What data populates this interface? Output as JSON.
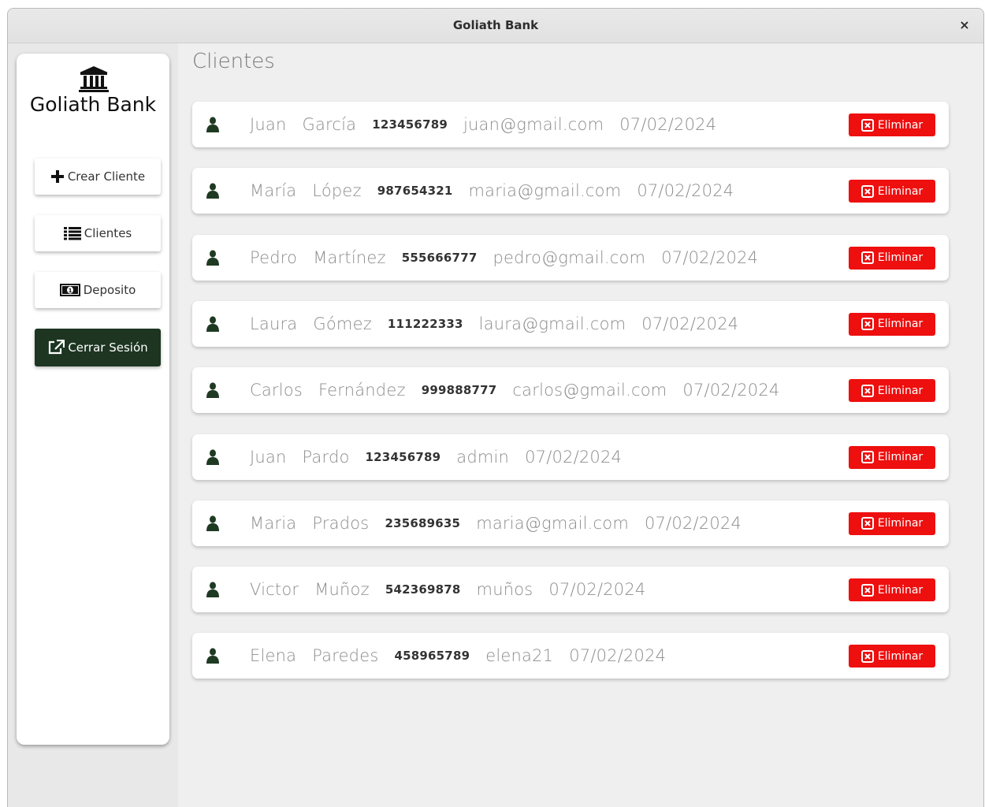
{
  "window": {
    "title": "Goliath Bank",
    "close_glyph": "×"
  },
  "sidebar": {
    "brand": "Goliath Bank",
    "logo_icon": "bank-icon",
    "buttons": [
      {
        "label": "Crear Cliente",
        "icon": "plus-icon"
      },
      {
        "label": "Clientes",
        "icon": "list-icon"
      },
      {
        "label": "Deposito",
        "icon": "money-bill-icon"
      },
      {
        "label": "Cerrar Sesión",
        "icon": "external-link-icon"
      }
    ]
  },
  "main": {
    "title": "Clientes",
    "delete_label": "Eliminar",
    "clients": [
      {
        "nombre": "Juan",
        "apellido": "García",
        "id": "123456789",
        "email": "juan@gmail.com",
        "fecha": "07/02/2024"
      },
      {
        "nombre": "María",
        "apellido": "López",
        "id": "987654321",
        "email": "maria@gmail.com",
        "fecha": "07/02/2024"
      },
      {
        "nombre": "Pedro",
        "apellido": "Martínez",
        "id": "555666777",
        "email": "pedro@gmail.com",
        "fecha": "07/02/2024"
      },
      {
        "nombre": "Laura",
        "apellido": "Gómez",
        "id": "111222333",
        "email": "laura@gmail.com",
        "fecha": "07/02/2024"
      },
      {
        "nombre": "Carlos",
        "apellido": "Fernández",
        "id": "999888777",
        "email": "carlos@gmail.com",
        "fecha": "07/02/2024"
      },
      {
        "nombre": "Juan",
        "apellido": "Pardo",
        "id": "123456789",
        "email": "admin",
        "fecha": "07/02/2024"
      },
      {
        "nombre": "Maria",
        "apellido": "Prados",
        "id": "235689635",
        "email": "maria@gmail.com",
        "fecha": "07/02/2024"
      },
      {
        "nombre": "Victor",
        "apellido": "Muñoz",
        "id": "542369878",
        "email": "muños",
        "fecha": "07/02/2024"
      },
      {
        "nombre": "Elena",
        "apellido": "Paredes",
        "id": "458965789",
        "email": "elena21",
        "fecha": "07/02/2024"
      }
    ]
  },
  "colors": {
    "delete": "#ee0f0f",
    "dark_button": "#1d3521",
    "user_icon": "#1f3a22"
  }
}
